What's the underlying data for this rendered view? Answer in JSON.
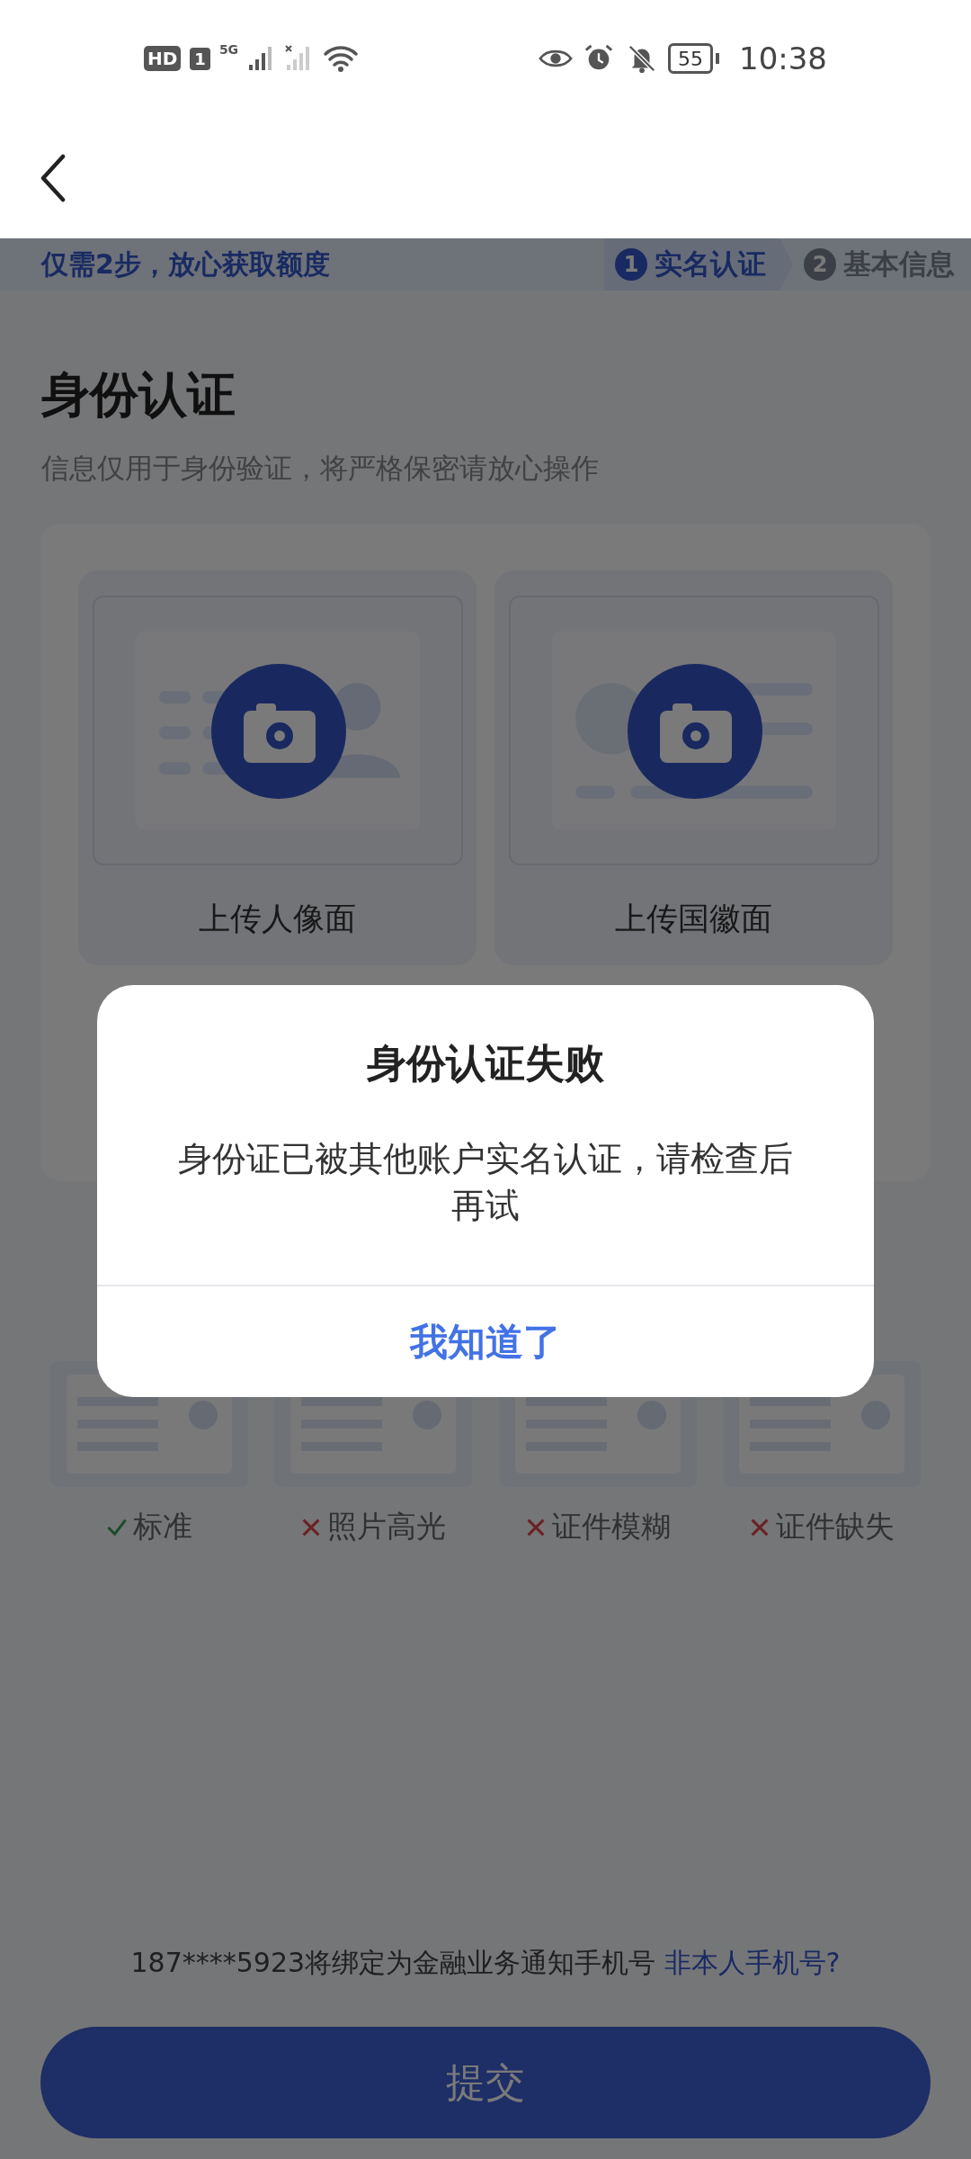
{
  "status_bar": {
    "hd": "HD",
    "sim": "1",
    "network": "5G",
    "battery": "55",
    "time": "10:38"
  },
  "steps": {
    "tagline": "仅需2步，放心获取额度",
    "items": [
      {
        "number": "1",
        "label": "实名认证",
        "selected": true
      },
      {
        "number": "2",
        "label": "基本信息",
        "selected": false
      }
    ]
  },
  "title": "身份认证",
  "subtitle": "信息仅用于身份验证，将严格保密请放心操作",
  "uploads": [
    {
      "label": "上传人像面",
      "kind": "portrait"
    },
    {
      "label": "上传国徽面",
      "kind": "emblem"
    }
  ],
  "examples": [
    {
      "label": "标准",
      "kind": "good"
    },
    {
      "label": "照片高光",
      "kind": "bad"
    },
    {
      "label": "证件模糊",
      "kind": "bad"
    },
    {
      "label": "证件缺失",
      "kind": "bad"
    }
  ],
  "phone_notice": {
    "text": "187****5923将绑定为金融业务通知手机号",
    "link": "非本人手机号?"
  },
  "submit": "提交",
  "dialog": {
    "title": "身份认证失败",
    "message": "身份证已被其他账户实名认证，请检查后再试",
    "button": "我知道了"
  }
}
